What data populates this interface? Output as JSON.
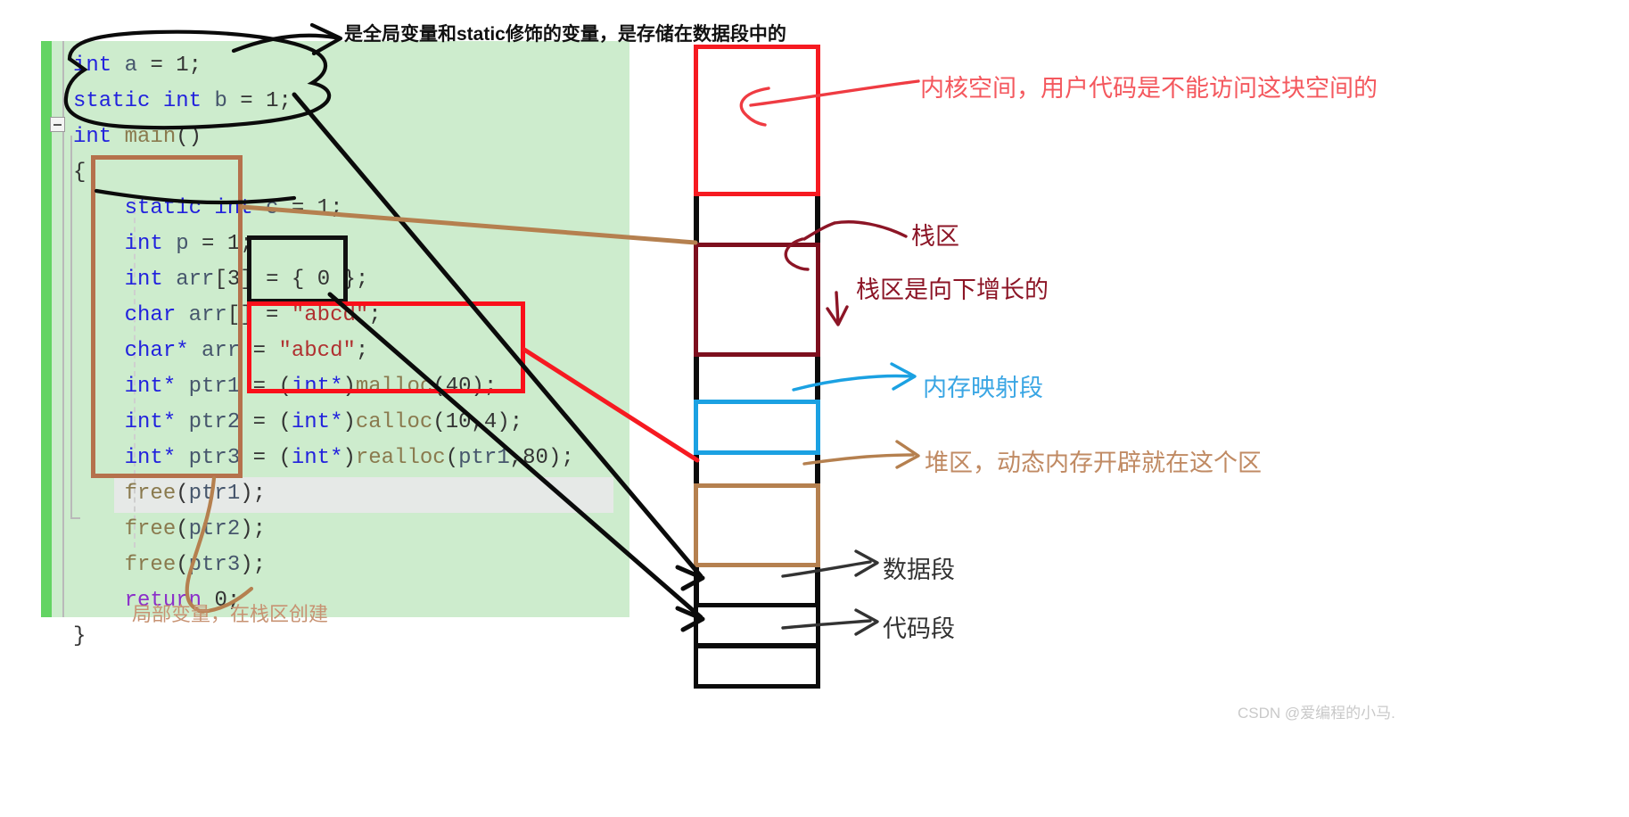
{
  "code": {
    "lines": [
      "int a = 1;",
      "static int b = 1;",
      "int main()",
      "{",
      "    static int c = 1;",
      "    int p = 1;",
      "    int arr[3] = { 0 };",
      "    char arr[] = \"abcd\";",
      "    char* arr = \"abcd\";",
      "    int* ptr1 = (int*)malloc(40);",
      "    int* ptr2 = (int*)calloc(10,4);",
      "    int* ptr3 = (int*)realloc(ptr1,80);",
      "    free(ptr1);",
      "    free(ptr2);",
      "    free(ptr3);",
      "    return 0;",
      "}"
    ],
    "fold_marker": "collapse-minus"
  },
  "memory_diagram": {
    "segments": [
      {
        "name": "kernel-space",
        "color": "#f61a21"
      },
      {
        "name": "stack",
        "color": "#7d0f1e"
      },
      {
        "name": "memory-mapping",
        "color": "#1ba1e2"
      },
      {
        "name": "heap",
        "color": "#b5804f"
      },
      {
        "name": "data-segment",
        "color": "#0b0b0b"
      },
      {
        "name": "code-segment",
        "color": "#0b0b0b"
      }
    ]
  },
  "annotations": {
    "global_note": "是全局变量和static修饰的变量，是存储在数据段中的",
    "kernel": "内核空间，用户代码是不能访问这块空间的",
    "stack": "栈区",
    "stack_growth": "栈区是向下增长的",
    "mmap": "内存映射段",
    "heap": "堆区，动态内存开辟就在这个区",
    "data_segment": "数据段",
    "code_segment": "代码段",
    "local_var": "局部变量，在栈区创建"
  },
  "watermark": {
    "text": "CSDN @爱编程的小马."
  },
  "colors": {
    "editor_background": "#cdeccd",
    "editor_marker_green": "#63d463",
    "red": "#f61a21",
    "dark_red": "#7d0f1e",
    "blue": "#1ba1e2",
    "brown": "#b5804f",
    "black": "#0b0b0b",
    "annotation_pink": "#f4585e",
    "annotation_brown": "#c08a63"
  }
}
